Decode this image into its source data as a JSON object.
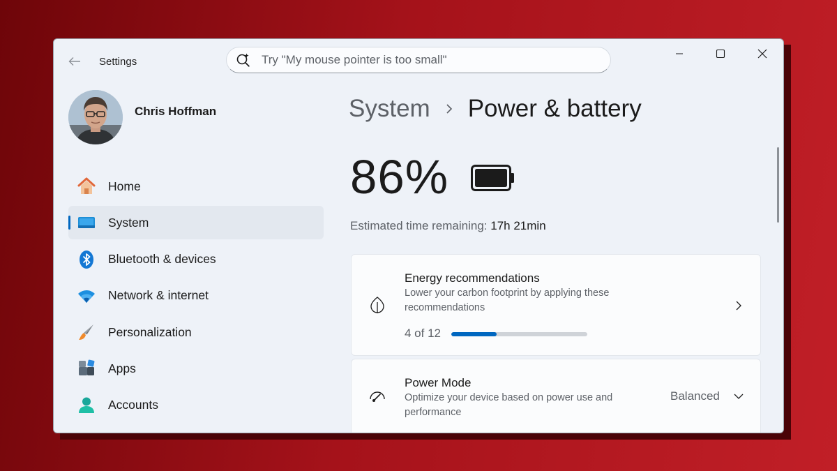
{
  "app": {
    "title": "Settings"
  },
  "search": {
    "placeholder": "Try \"My mouse pointer is too small\""
  },
  "user": {
    "name": "Chris Hoffman"
  },
  "sidebar": {
    "items": [
      {
        "label": "Home",
        "icon": "home-icon"
      },
      {
        "label": "System",
        "icon": "system-icon",
        "selected": true
      },
      {
        "label": "Bluetooth & devices",
        "icon": "bluetooth-icon"
      },
      {
        "label": "Network & internet",
        "icon": "wifi-icon"
      },
      {
        "label": "Personalization",
        "icon": "brush-icon"
      },
      {
        "label": "Apps",
        "icon": "apps-icon"
      },
      {
        "label": "Accounts",
        "icon": "accounts-icon"
      }
    ]
  },
  "breadcrumb": {
    "parent": "System",
    "current": "Power & battery"
  },
  "battery": {
    "percent_text": "86%",
    "level": 0.86,
    "estimate_label": "Estimated time remaining:",
    "estimate_value": "17h 21min"
  },
  "energy_card": {
    "title": "Energy recommendations",
    "description": "Lower your carbon footprint by applying these recommendations",
    "progress_text": "4 of 12",
    "progress_fraction": 0.333
  },
  "power_mode_card": {
    "title": "Power Mode",
    "description": "Optimize your device based on power use and performance",
    "value": "Balanced"
  },
  "colors": {
    "accent": "#0067c0",
    "background": "#b3141c",
    "window": "#eef2f8"
  }
}
